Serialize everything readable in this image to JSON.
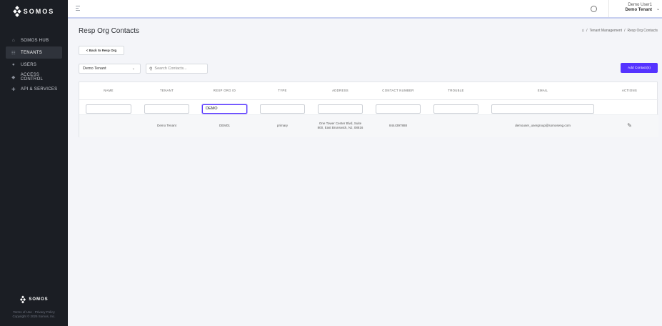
{
  "sidebar": {
    "logo_text": "SOMOS",
    "items": [
      {
        "label": "SOMOS HUB",
        "icon": "home-icon",
        "glyph": "⌂"
      },
      {
        "label": "TENANTS",
        "icon": "users-icon",
        "glyph": "☷"
      },
      {
        "label": "USERS",
        "icon": "user-icon",
        "glyph": "●"
      },
      {
        "label": "ACCESS CONTROL",
        "icon": "shield-icon",
        "glyph": "◆"
      },
      {
        "label": "API & SERVICES",
        "icon": "plug-icon",
        "glyph": "✚"
      }
    ],
    "active_index": 1,
    "footer_logo": "SOMOS",
    "footer_links": "Terms of Use · Privacy Policy",
    "footer_copyright": "Copyright © 2025 Somos, Inc."
  },
  "topbar": {
    "user_name": "Demo User1",
    "user_tenant": "Demo Tenant"
  },
  "page": {
    "title": "Resp Org Contacts",
    "breadcrumb": [
      "Tenant Management",
      "Resp Org Contacts"
    ],
    "back_button": "< Back to Resp Org",
    "tenant_select": "Demo Tenant",
    "search_placeholder": "Search Contacts...",
    "add_button": "Add Contact(s)"
  },
  "table": {
    "columns": [
      "NAME",
      "TENANT",
      "RESP ORG ID",
      "TYPE",
      "ADDRESS",
      "CONTACT NUMBER",
      "TROUBLE",
      "EMAIL",
      "ACTIONS"
    ],
    "filters": [
      "",
      "",
      "DEMO",
      "",
      "",
      "",
      "",
      ""
    ],
    "rows": [
      {
        "name": "",
        "tenant": "Demo Tenant",
        "resp_org_id": "DEM01",
        "type": "primary",
        "address": "One Tower Center Blvd, Suite 800, East Brunswick, NJ, 08816",
        "contact_number": "8444397888",
        "trouble": "",
        "email": "demouser_usergroup@somoseng.com"
      }
    ]
  },
  "colors": {
    "accent": "#5533ff",
    "sidebar_bg": "#1b1e24",
    "page_bg": "#f4f5f9"
  }
}
